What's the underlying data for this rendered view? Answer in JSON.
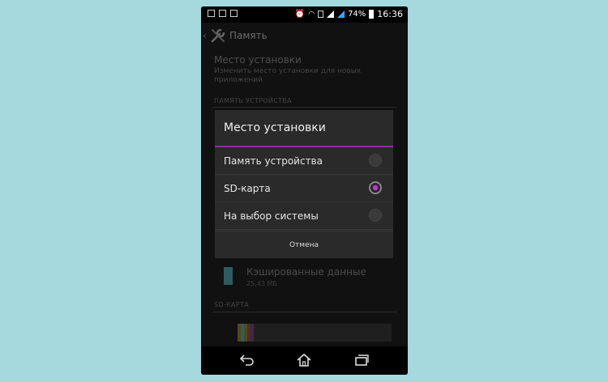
{
  "status_bar": {
    "battery": "74%",
    "time": "16:36"
  },
  "action_bar": {
    "title": "Память",
    "icons": [
      "back-chevron-icon",
      "wrench-icon"
    ]
  },
  "background_settings": {
    "install_location_title": "Место установки",
    "install_location_desc": "Изменить место установки для новых приложений",
    "section_device_memory": "ПАМЯТЬ УСТРОЙСТВА",
    "cached_data_label": "Кэшированные данные",
    "cached_data_size": "25,43 МБ",
    "section_sd_card": "SD-КАРТА"
  },
  "dialog": {
    "title": "Место установки",
    "options": [
      {
        "label": "Память устройства",
        "selected": false
      },
      {
        "label": "SD-карта",
        "selected": true
      },
      {
        "label": "На выбор системы",
        "selected": false
      }
    ],
    "cancel_label": "Отмена",
    "accent_color": "#8a2f9e"
  },
  "nav_bar": {
    "icons": [
      "back-icon",
      "home-icon",
      "recent-apps-icon"
    ]
  }
}
